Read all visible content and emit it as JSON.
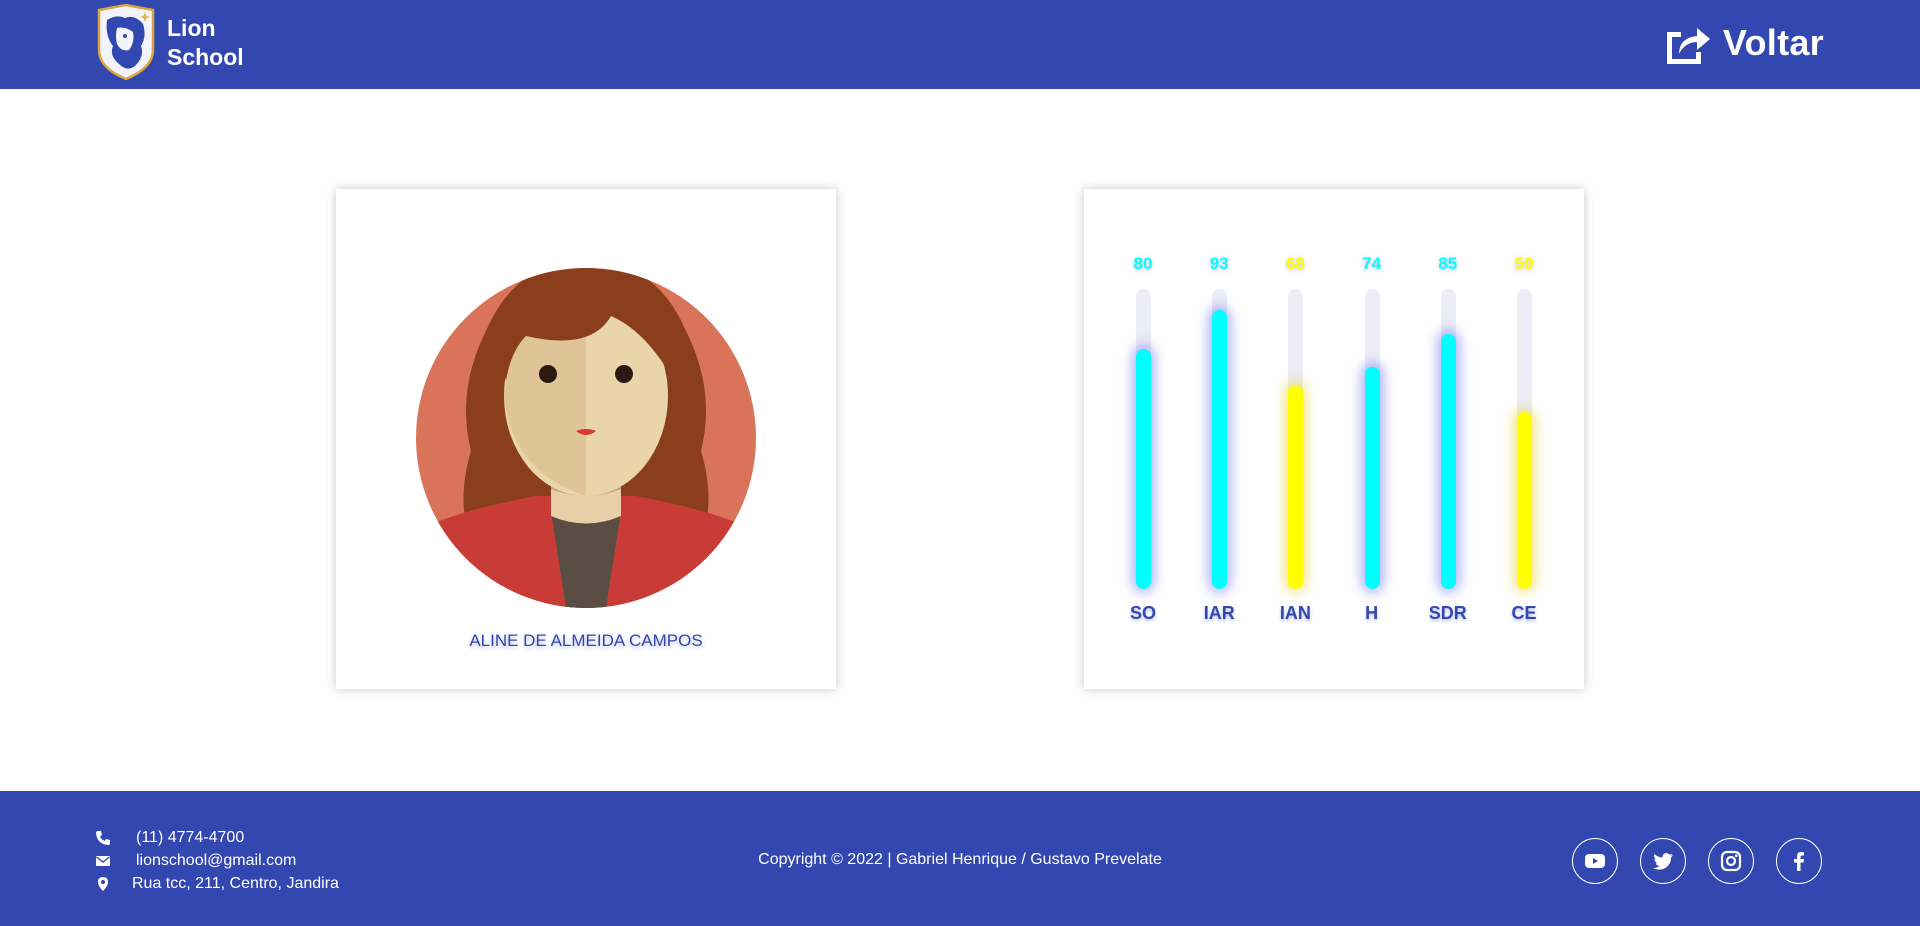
{
  "header": {
    "brand_line1": "Lion",
    "brand_line2": "School",
    "back_label": "Voltar"
  },
  "student": {
    "name": "ALINE DE ALMEIDA CAMPOS"
  },
  "chart_data": {
    "type": "bar",
    "categories": [
      "SO",
      "IAR",
      "IAN",
      "H",
      "SDR",
      "CE"
    ],
    "values": [
      80,
      93,
      68,
      74,
      85,
      59
    ],
    "ylim": [
      0,
      100
    ],
    "colors": [
      "#00ffff",
      "#00ffff",
      "#ffff00",
      "#00ffff",
      "#00ffff",
      "#ffff00"
    ]
  },
  "footer": {
    "phone": "(11) 4774-4700",
    "email": "lionschool@gmail.com",
    "address": "Rua tcc, 211, Centro, Jandira",
    "copyright": "Copyright © 2022 | Gabriel Henrique / Gustavo Prevelate",
    "social": [
      "youtube-icon",
      "twitter-icon",
      "instagram-icon",
      "facebook-icon"
    ]
  },
  "colors": {
    "brand_blue": "#3347b0",
    "cyan": "#00ffff",
    "yellow": "#ffff00"
  }
}
